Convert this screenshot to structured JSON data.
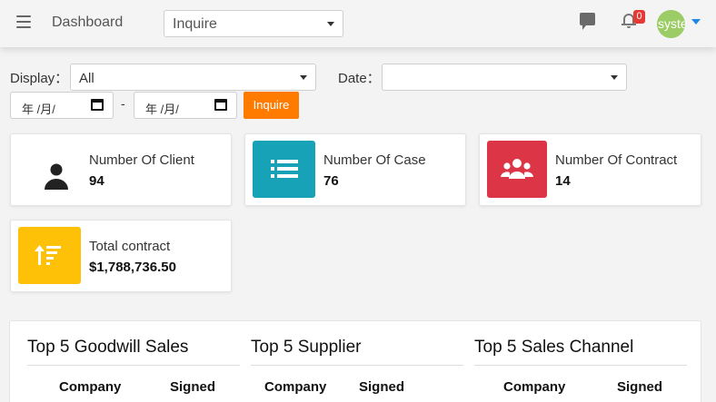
{
  "topbar": {
    "title": "Dashboard",
    "select_value": "Inquire",
    "notification_count": "0",
    "user_name": "system"
  },
  "filters": {
    "display_label": "Display：",
    "display_value": "All",
    "date_label": "Date：",
    "date_value": "",
    "date_from_placeholder": "年 /月/",
    "date_to_placeholder": "年 /月/",
    "range_separator": "-",
    "inquire_button": "Inquire"
  },
  "stats": [
    {
      "title": "Number Of Client",
      "value": "94",
      "icon": "user-icon",
      "color": "#ffffff"
    },
    {
      "title": "Number Of Case",
      "value": "76",
      "icon": "list-icon",
      "color": "#17a2b8"
    },
    {
      "title": "Number Of Contract",
      "value": "14",
      "icon": "users-icon",
      "color": "#dc3545"
    },
    {
      "title": "Total contract",
      "value": "$1,788,736.50",
      "icon": "sort-amount-icon",
      "color": "#ffc107"
    }
  ],
  "panels": [
    {
      "title": "Top 5 Goodwill Sales",
      "columns": [
        "Company",
        "Signed"
      ]
    },
    {
      "title": "Top 5 Supplier",
      "columns": [
        "Company",
        "Signed"
      ]
    },
    {
      "title": "Top 5 Sales Channel",
      "columns": [
        "Company",
        "Signed"
      ]
    }
  ]
}
